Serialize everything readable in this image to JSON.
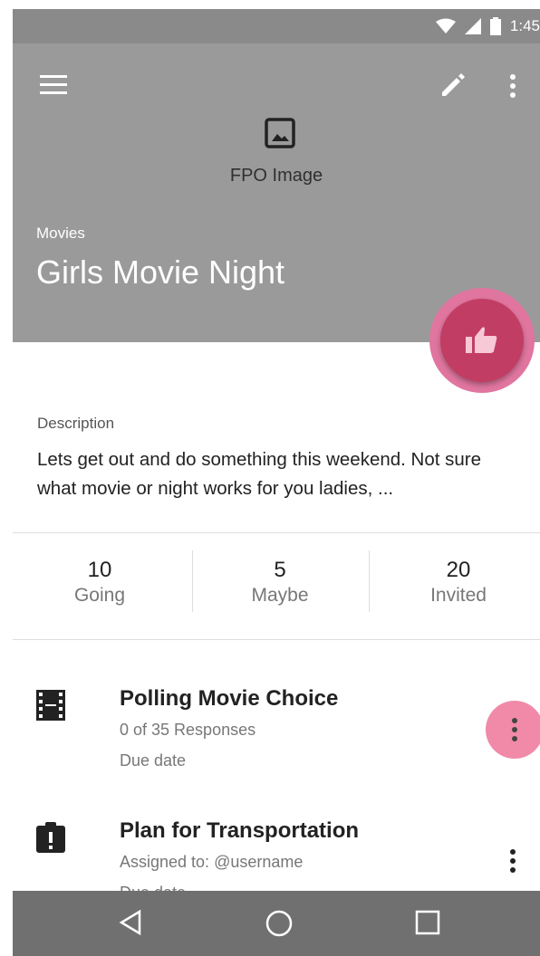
{
  "status_bar": {
    "time": "1:45",
    "icons": [
      "wifi-icon",
      "signal-icon",
      "battery-icon"
    ]
  },
  "header": {
    "menu_icon": "menu-icon",
    "edit_icon": "edit-icon",
    "more_icon": "more-vert-icon",
    "image_placeholder_label": "FPO Image",
    "category": "Movies",
    "title": "Girls Movie Night"
  },
  "fab": {
    "icon": "thumb-up-icon",
    "color": "#c23d64"
  },
  "description": {
    "label": "Description",
    "text": "Lets get out and do something this weekend. Not sure what movie or night works for you ladies, ..."
  },
  "stats": [
    {
      "value": "10",
      "label": "Going"
    },
    {
      "value": "5",
      "label": "Maybe"
    },
    {
      "value": "20",
      "label": "Invited"
    }
  ],
  "tasks": [
    {
      "icon": "film-icon",
      "title": "Polling Movie Choice",
      "subtitle": "0 of 35 Responses",
      "due": "Due date"
    },
    {
      "icon": "clipboard-alert-icon",
      "title": "Plan for Transportation",
      "subtitle": "Assigned to: @username",
      "due": "Due date"
    }
  ],
  "nav_bar": {
    "buttons": [
      "back-icon",
      "home-icon",
      "recents-icon"
    ]
  },
  "colors": {
    "header_bg": "#9a9a9a",
    "accent_pink": "#f08aa8",
    "nav_bg": "#707070"
  }
}
